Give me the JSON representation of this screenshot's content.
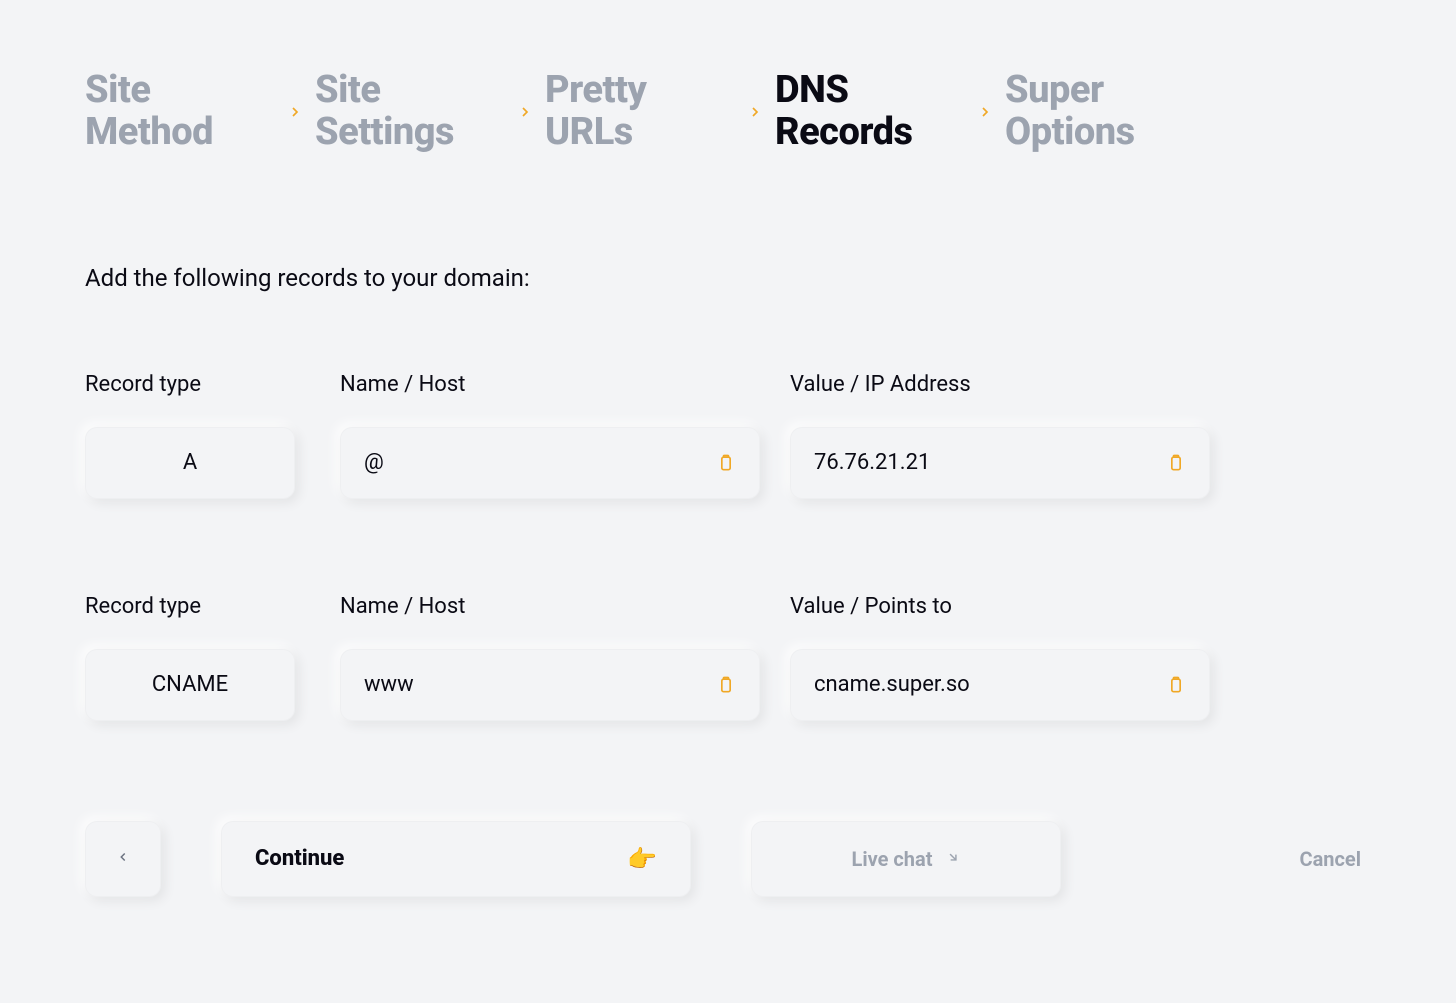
{
  "breadcrumb": {
    "items": [
      {
        "label": "Site Method",
        "active": false
      },
      {
        "label": "Site Settings",
        "active": false
      },
      {
        "label": "Pretty URLs",
        "active": false
      },
      {
        "label": "DNS Records",
        "active": true
      },
      {
        "label": "Super Options",
        "active": false
      }
    ]
  },
  "instruction": "Add the following records to your domain:",
  "labels": {
    "record_type": "Record type",
    "name_host": "Name / Host",
    "value_ip": "Value / IP Address",
    "value_points": "Value / Points to"
  },
  "records": [
    {
      "type": "A",
      "name": "@",
      "value": "76.76.21.21",
      "value_label_key": "value_ip"
    },
    {
      "type": "CNAME",
      "name": "www",
      "value": "cname.super.so",
      "value_label_key": "value_points"
    }
  ],
  "footer": {
    "continue_label": "Continue",
    "continue_emoji": "👉",
    "livechat_label": "Live chat",
    "cancel_label": "Cancel"
  },
  "icons": {
    "chevron_right": "chevron-right-icon",
    "chevron_left": "chevron-left-icon",
    "clipboard": "clipboard-icon",
    "arrow_dr": "arrow-down-right-icon"
  }
}
